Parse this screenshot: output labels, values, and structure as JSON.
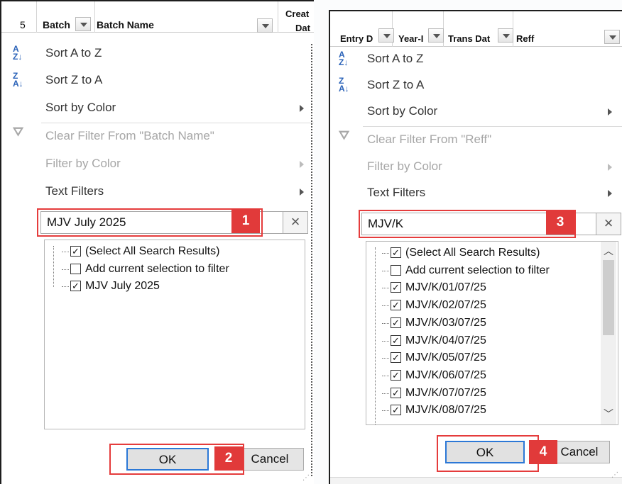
{
  "left": {
    "header": {
      "row_num": "5",
      "col_batch": "Batch",
      "col_batch_name": "Batch Name",
      "col_created_top": "Creat",
      "col_created_bottom": "Dat"
    },
    "menu": {
      "sort_az": "Sort A to Z",
      "sort_za": "Sort Z to A",
      "sort_color": "Sort by Color",
      "clear_filter": "Clear Filter From \"Batch Name\"",
      "filter_color": "Filter by Color",
      "text_filters": "Text Filters"
    },
    "search": {
      "value": "MJV July 2025"
    },
    "badge_search": "1",
    "list": [
      {
        "label": "(Select All Search Results)",
        "checked": true
      },
      {
        "label": "Add current selection to filter",
        "checked": false
      },
      {
        "label": "MJV July 2025",
        "checked": true
      }
    ],
    "ok_label": "OK",
    "cancel_label": "Cancel",
    "badge_ok": "2"
  },
  "right": {
    "header": {
      "col_entry": "Entry D",
      "col_year": "Year-I",
      "col_trans": "Trans Dat",
      "col_reff": "Reff"
    },
    "menu": {
      "sort_az": "Sort A to Z",
      "sort_za": "Sort Z to A",
      "sort_color": "Sort by Color",
      "clear_filter": "Clear Filter From \"Reff\"",
      "filter_color": "Filter by Color",
      "text_filters": "Text Filters"
    },
    "search": {
      "value": "MJV/K"
    },
    "badge_search": "3",
    "list": [
      {
        "label": "(Select All Search Results)",
        "checked": true
      },
      {
        "label": "Add current selection to filter",
        "checked": false
      },
      {
        "label": "MJV/K/01/07/25",
        "checked": true
      },
      {
        "label": "MJV/K/02/07/25",
        "checked": true
      },
      {
        "label": "MJV/K/03/07/25",
        "checked": true
      },
      {
        "label": "MJV/K/04/07/25",
        "checked": true
      },
      {
        "label": "MJV/K/05/07/25",
        "checked": true
      },
      {
        "label": "MJV/K/06/07/25",
        "checked": true
      },
      {
        "label": "MJV/K/07/07/25",
        "checked": true
      },
      {
        "label": "MJV/K/08/07/25",
        "checked": true
      }
    ],
    "ok_label": "OK",
    "cancel_label": "Cancel",
    "badge_ok": "4"
  },
  "colors": {
    "callout": "#e53c3c",
    "ok_border": "#2c78d6",
    "sort_icon": "#2a62b8"
  },
  "icons": {
    "sort_az": "sort-az-icon",
    "sort_za": "sort-za-icon",
    "clear_filter": "clear-filter-icon",
    "submenu": "chevron-right-icon",
    "clear_search": "close-icon"
  }
}
